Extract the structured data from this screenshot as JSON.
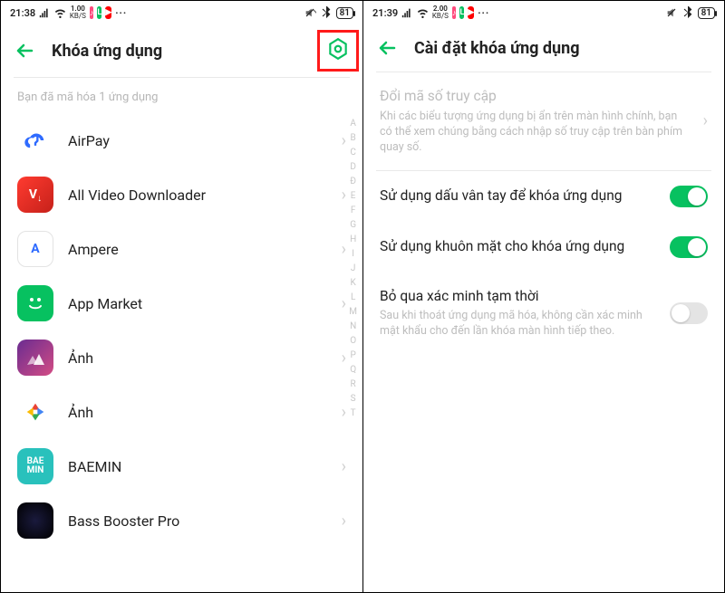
{
  "left": {
    "status": {
      "time": "21:38",
      "kbs_n": "1.00",
      "kbs_u": "KB/S",
      "battery": "81"
    },
    "header": {
      "title": "Khóa ứng dụng"
    },
    "caption": "Bạn đã mã hóa 1 ứng dụng",
    "apps": [
      {
        "name": "AirPay"
      },
      {
        "name": "All Video Downloader"
      },
      {
        "name": "Ampere"
      },
      {
        "name": "App Market"
      },
      {
        "name": "Ảnh"
      },
      {
        "name": "Ảnh"
      },
      {
        "name": "BAEMIN"
      },
      {
        "name": "Bass Booster Pro"
      }
    ],
    "index": [
      "A",
      "B",
      "C",
      "D",
      "Đ",
      "E",
      "F",
      "G",
      "H",
      "I",
      "J",
      "K",
      "L",
      "M",
      "N",
      "O",
      "P",
      "Q",
      "R",
      "S",
      "T"
    ]
  },
  "right": {
    "status": {
      "time": "21:39",
      "kbs_n": "2.00",
      "kbs_u": "KB/S",
      "battery": "81"
    },
    "header": {
      "title": "Cài đặt khóa ứng dụng"
    },
    "passcode": {
      "title": "Đổi mã số truy cập",
      "desc": "Khi các biểu tượng ứng dụng bị ẩn trên màn hình chính, bạn có thể xem chúng bằng cách nhập số truy cập trên bàn phím quay số."
    },
    "settings": [
      {
        "title": "Sử dụng dấu vân tay để khóa ứng dụng",
        "on": true
      },
      {
        "title": "Sử dụng khuôn mặt cho khóa ứng dụng",
        "on": true
      },
      {
        "title": "Bỏ qua xác minh tạm thời",
        "desc": "Sau khi thoát ứng dụng mã hóa, không cần xác minh mật khẩu cho đến lần khóa màn hình tiếp theo.",
        "on": false
      }
    ]
  }
}
